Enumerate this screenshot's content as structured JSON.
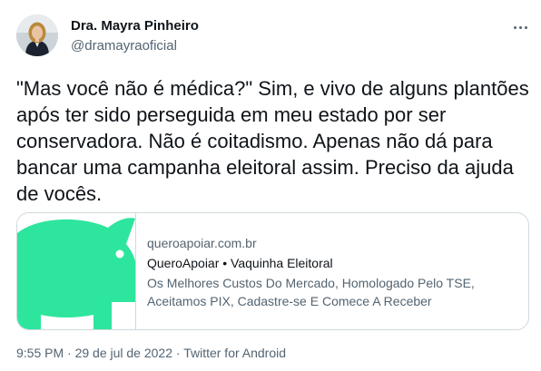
{
  "author": {
    "name": "Dra. Mayra Pinheiro",
    "handle": "@dramayraoficial"
  },
  "tweet": {
    "text": "\"Mas você não é médica?\" Sim, e vivo de alguns plantões após ter sido perseguida em meu estado por ser conservadora. Não é coitadismo. Apenas não dá para bancar uma campanha eleitoral assim. Preciso da ajuda de vocês."
  },
  "link_card": {
    "domain": "queroapoiar.com.br",
    "title": "QueroApoiar • Vaquinha Eleitoral",
    "description": "Os Melhores Custos Do Mercado, Homologado Pelo TSE, Aceitamos PIX, Cadastre-se E Comece A Receber",
    "image_icon": "piggy-bank-icon",
    "image_color": "#2ee59d"
  },
  "meta": {
    "text": "9:55 PM · 29 de jul de 2022 · Twitter for Android"
  },
  "colors": {
    "text_primary": "#0f1419",
    "text_secondary": "#536471",
    "border": "#cfd9de"
  }
}
